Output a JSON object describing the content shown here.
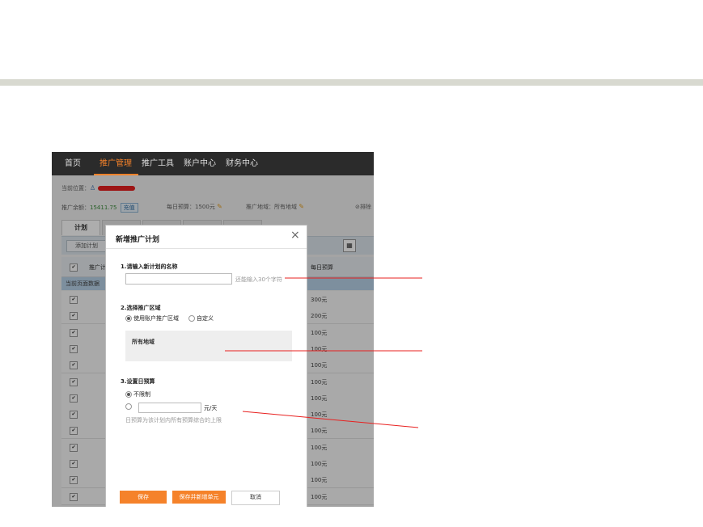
{
  "nav": {
    "items": [
      "首页",
      "推广管理",
      "推广工具",
      "账户中心",
      "财务中心"
    ],
    "active_index": 1
  },
  "breadcrumb": {
    "label": "当前位置："
  },
  "account": {
    "balance_label": "推广余额：",
    "balance_value": "15411.75",
    "recharge_label": "充值",
    "daily_budget_label": "每日预算：",
    "daily_budget_value": "1500元",
    "region_label": "推广地域：",
    "region_value": "所有地域",
    "exclude_label": "⊘排除"
  },
  "tabs": {
    "active_label": "计划"
  },
  "toolbar": {
    "add_plan_label": "添加计划",
    "calendar_icon": "calendar-icon"
  },
  "grid": {
    "col_name": "推广计",
    "col_budget": "每日预算",
    "notice": "当前页面数据",
    "budgets": [
      "300元",
      "200元",
      "100元",
      "100元",
      "100元",
      "100元",
      "100元",
      "100元",
      "100元",
      "100元",
      "100元",
      "100元",
      "100元"
    ]
  },
  "modal": {
    "title": "新增推广计划",
    "close": "×",
    "step1_label": "1.请输入新计划的名称",
    "step1_hint": "还能输入30个字符",
    "step2_label": "2.选择推广区域",
    "step2_opt_account": "使用账户推广区域",
    "step2_opt_custom": "自定义",
    "step2_region_text": "所有地域",
    "step3_label": "3.设置日预算",
    "step3_opt_unlimited": "不限制",
    "step3_unit": "元/天",
    "step3_hint": "日预算为该计划内所有预算综合的上限",
    "save_label": "保存",
    "save_add_label": "保存并新增单元",
    "cancel_label": "取消"
  },
  "colors": {
    "accent": "#f5822a",
    "nav_bg": "#2b2b2b",
    "annotation_line": "#e8201f"
  }
}
